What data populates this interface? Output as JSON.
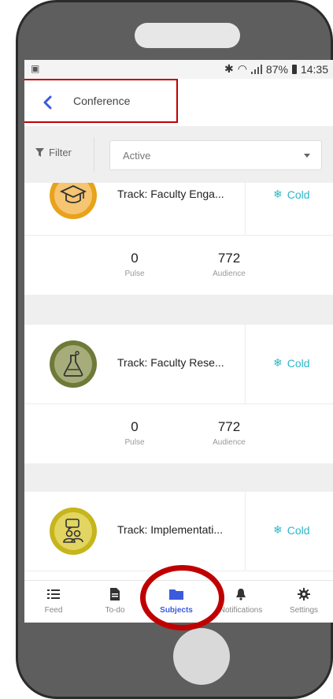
{
  "status_bar": {
    "battery": "87%",
    "time": "14:35"
  },
  "header": {
    "title": "Conference"
  },
  "filter": {
    "label": "Filter",
    "selected": "Active"
  },
  "tracks": [
    {
      "name": "Track: Faculty Enga...",
      "status": "Cold",
      "pulse_value": "0",
      "pulse_label": "Pulse",
      "audience_value": "772",
      "audience_label": "Audience",
      "icon": "graduation-cap-icon",
      "ring_color": "#e8a21c",
      "fill_color": "#f6c572"
    },
    {
      "name": "Track: Faculty Rese...",
      "status": "Cold",
      "pulse_value": "0",
      "pulse_label": "Pulse",
      "audience_value": "772",
      "audience_label": "Audience",
      "icon": "flask-icon",
      "ring_color": "#6f7a3a",
      "fill_color": "#a6ad7a"
    },
    {
      "name": "Track: Implementati...",
      "status": "Cold",
      "pulse_value": "",
      "pulse_label": "",
      "audience_value": "",
      "audience_label": "",
      "icon": "people-chat-icon",
      "ring_color": "#c6b51b",
      "fill_color": "#e2d561"
    }
  ],
  "tabs": [
    {
      "label": "Feed",
      "icon": "list-icon"
    },
    {
      "label": "To-do",
      "icon": "document-icon"
    },
    {
      "label": "Subjects",
      "icon": "folder-icon",
      "active": true
    },
    {
      "label": "Notifications",
      "icon": "bell-icon"
    },
    {
      "label": "Settings",
      "icon": "gear-icon"
    }
  ],
  "colors": {
    "accent": "#3b5bdb",
    "cold": "#2bb7c9",
    "annotation": "#c00000"
  }
}
